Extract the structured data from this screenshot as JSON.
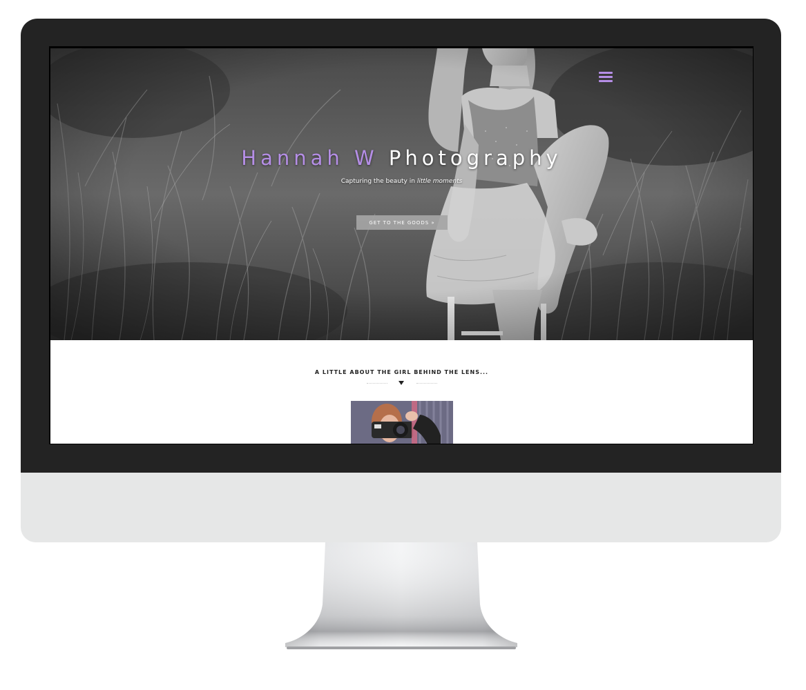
{
  "site": {
    "title_first": "Hannah W",
    "title_second": "Photography",
    "tagline_prefix": "Capturing the beauty in",
    "tagline_emphasis": "little moments",
    "cta_label": "GET TO THE GOODS »"
  },
  "about": {
    "heading": "A LITTLE ABOUT THE GIRL BEHIND THE LENS..."
  },
  "icons": {
    "menu": "hamburger-menu-icon",
    "divider": "chevron-down-icon"
  },
  "colors": {
    "accent": "#b58ee6",
    "bezel": "#232323",
    "chin": "#e6e7e7",
    "cta_background": "#a5a5a5"
  }
}
